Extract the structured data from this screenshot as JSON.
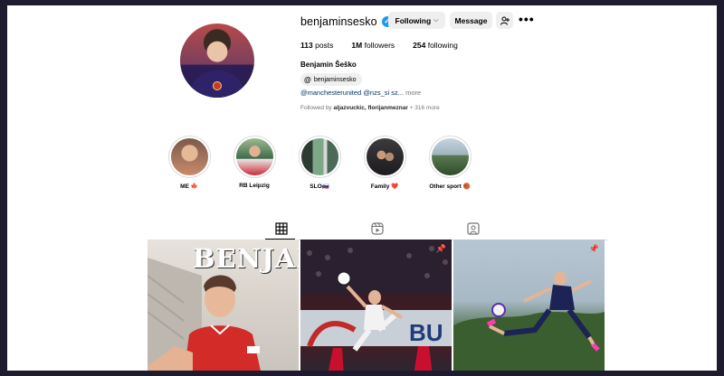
{
  "profile": {
    "username": "benjaminsesko",
    "verified_icon": "verified-badge-icon",
    "following_label": "Following",
    "message_label": "Message",
    "stats": {
      "posts_count": "113",
      "posts_label": "posts",
      "followers_count": "1M",
      "followers_label": "followers",
      "following_count": "254",
      "following_label": "following"
    },
    "full_name": "Benjamin Šeško",
    "threads_handle": "benjaminsesko",
    "bio_links": "@manchesterunited @nzs_si sz...",
    "bio_more": "more",
    "followed_by_prefix": "Followed by",
    "followed_by_names": "aljazvuckic, florijanmeznar",
    "followed_by_suffix": "+ 316 more"
  },
  "highlights": [
    {
      "label": "ME 🍁",
      "color": "#c98a6b"
    },
    {
      "label": "RB Leipzig",
      "color": "#3f6a4b"
    },
    {
      "label": "SLO🇸🇮",
      "color": "#4b6a58"
    },
    {
      "label": "Family ❤️",
      "color": "#2b2a2d"
    },
    {
      "label": "Other sport 🏀",
      "color": "#5a7a52"
    }
  ],
  "tabs": [
    "posts-grid-icon",
    "reels-icon",
    "tagged-icon"
  ],
  "posts": [
    {
      "title": "BENJAMIN",
      "pinned": false
    },
    {
      "pinned": true
    },
    {
      "pinned": true
    }
  ],
  "colors": {
    "link": "#00376b",
    "button_bg": "#efefef",
    "verified": "#1d9bf0",
    "secondary_text": "#737373"
  }
}
